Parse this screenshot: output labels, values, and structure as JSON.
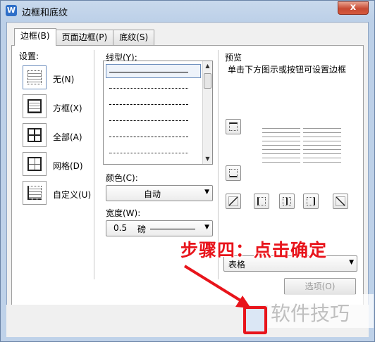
{
  "window": {
    "title": "边框和底纹",
    "app_icon": "W",
    "close": "x"
  },
  "tabs": [
    {
      "label": "边框(B)"
    },
    {
      "label": "页面边框(P)"
    },
    {
      "label": "底纹(S)"
    }
  ],
  "settings": {
    "heading": "设置:",
    "items": [
      {
        "label": "无(N)",
        "icon": "border-none-icon"
      },
      {
        "label": "方框(X)",
        "icon": "border-box-icon"
      },
      {
        "label": "全部(A)",
        "icon": "border-all-icon"
      },
      {
        "label": "网格(D)",
        "icon": "border-grid-icon"
      },
      {
        "label": "自定义(U)",
        "icon": "border-custom-icon"
      }
    ]
  },
  "line_style": {
    "heading": "线型(Y):"
  },
  "color": {
    "heading": "颜色(C):",
    "value": "自动"
  },
  "width": {
    "heading": "宽度(W):",
    "value": "0.5",
    "unit": "磅"
  },
  "preview": {
    "heading": "预览",
    "hint": "单击下方图示或按钮可设置边框"
  },
  "apply_to": {
    "value": "表格"
  },
  "options_button": "选项(O)",
  "annotation": "步骤四：点击确定",
  "watermark": "软件技巧",
  "colors": {
    "annotation": "#e8141b",
    "accent": "#2f6fc8"
  }
}
